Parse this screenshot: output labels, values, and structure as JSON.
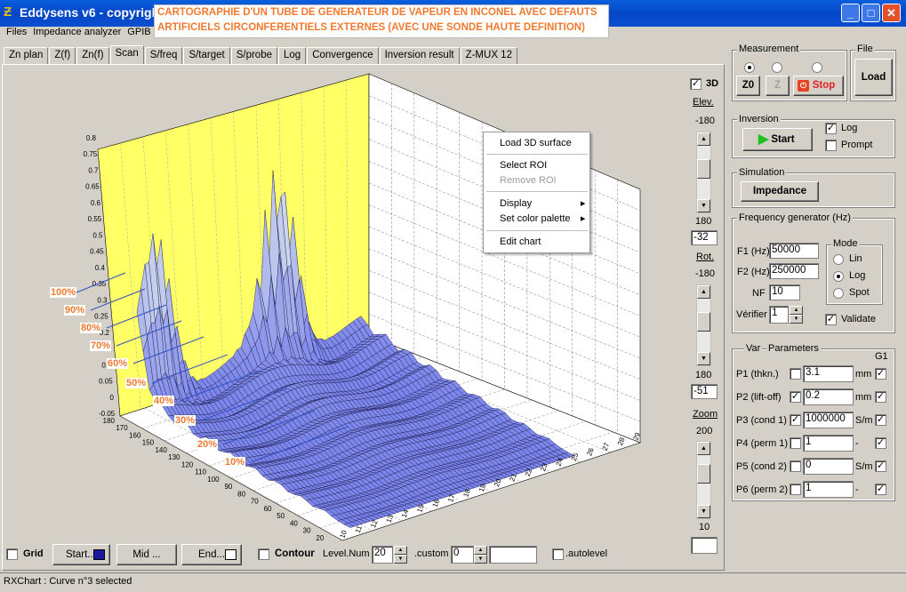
{
  "window": {
    "title": "Eddysens v6 - copyright"
  },
  "banner": {
    "line1": "CARTOGRAPHIE D'UN TUBE DE GENERATEUR DE VAPEUR EN INCONEL AVEC DEFAUTS",
    "line2": "ARTIFICIELS CIRCONFERENTIELS EXTERNES (AVEC UNE SONDE HAUTE DEFINITION)"
  },
  "menu": [
    "Files",
    "Impedance analyzer",
    "GPIB"
  ],
  "tabs": [
    "Zn plan",
    "Z(f)",
    "Zn(f)",
    "Scan",
    "S/freq",
    "S/target",
    "S/probe",
    "Log",
    "Convergence",
    "Inversion result",
    "Z-MUX 12"
  ],
  "active_tab": "Scan",
  "plot": {
    "z_ticks": [
      "0.8",
      "0.75",
      "0.7",
      "0.65",
      "0.6",
      "0.55",
      "0.5",
      "0.45",
      "0.4",
      "0.35",
      "0.3",
      "0.25",
      "0.2",
      "0.15",
      "0.1",
      "0.05",
      "0",
      "-0.05"
    ],
    "y_ticks": [
      "10",
      "20",
      "30",
      "40",
      "50",
      "60",
      "70",
      "80",
      "90",
      "100",
      "110",
      "120",
      "130",
      "140",
      "150",
      "160",
      "170",
      "180"
    ],
    "x_ticks": [
      "10",
      "11",
      "12",
      "13",
      "14",
      "15",
      "16",
      "17",
      "18",
      "19",
      "20",
      "21",
      "22",
      "23",
      "24",
      "25",
      "26",
      "27",
      "28",
      "29"
    ],
    "percent_labels": [
      "100%",
      "90%",
      "80%",
      "70%",
      "60%",
      "50%",
      "40%",
      "30%",
      "20%",
      "10%"
    ],
    "colors": {
      "wall": "#ffff66",
      "surface": "#8a95e8",
      "mesh": "#1a1a50",
      "floor": "#ffffff"
    }
  },
  "context_menu": {
    "items": [
      "Load 3D surface",
      "Select ROI",
      "Remove ROI",
      "Display",
      "Set color palette",
      "Edit chart"
    ]
  },
  "view3d": {
    "label_3d": "3D",
    "elev_label": "Elev.",
    "elev_max": "-180",
    "elev_min": "180",
    "elev_value": "-32",
    "rot_label": "Rot.",
    "rot_max": "-180",
    "rot_min": "180",
    "rot_value": "-51",
    "zoom_label": "Zoom",
    "zoom_max": "200",
    "zoom_min": "10",
    "zoom_value": ""
  },
  "measurement": {
    "label": "Measurement",
    "btn_z0": "Z0",
    "btn_z": "Z",
    "btn_stop": "Stop"
  },
  "file": {
    "label": "File",
    "btn_load": "Load"
  },
  "inversion": {
    "label": "Inversion",
    "btn_start": "Start",
    "log": "Log",
    "prompt": "Prompt"
  },
  "simulation": {
    "label": "Simulation",
    "btn_impedance": "Impedance"
  },
  "freqgen": {
    "label": "Frequency generator (Hz)",
    "f1_label": "F1 (Hz)",
    "f1_value": "50000",
    "f2_label": "F2 (Hz)",
    "f2_value": "250000",
    "nf_label": "NF",
    "nf_value": "10",
    "verifier_label": "Vérifier",
    "verifier_value": "1",
    "mode_label": "Mode",
    "mode_lin": "Lin",
    "mode_log": "Log",
    "mode_spot": "Spot",
    "validate": "Validate"
  },
  "params": {
    "label_var": "Var",
    "label_params": "Parameters",
    "label_g1": "G1",
    "rows": [
      {
        "name": "P1 (thkn.)",
        "value": "3.1",
        "unit": "mm",
        "var": false,
        "g1": true
      },
      {
        "name": "P2 (lift-off)",
        "value": "0.2",
        "unit": "mm",
        "var": true,
        "g1": true
      },
      {
        "name": "P3 (cond 1)",
        "value": "1000000",
        "unit": "S/m",
        "var": true,
        "g1": true
      },
      {
        "name": "P4 (perm 1)",
        "value": "1",
        "unit": "-",
        "var": false,
        "g1": true
      },
      {
        "name": "P5 (cond 2)",
        "value": "0",
        "unit": "S/m",
        "var": false,
        "g1": true
      },
      {
        "name": "P6 (perm 2)",
        "value": "1",
        "unit": "-",
        "var": false,
        "g1": true
      }
    ]
  },
  "bottom": {
    "grid": "Grid",
    "start": "Start...",
    "mid": "Mid ...",
    "end": "End...",
    "contour": "Contour",
    "level_num_label": "Level.Num",
    "level_num_value": "20",
    "custom_label": ".custom",
    "custom_value": "0",
    "autolevel": ".autolevel"
  },
  "status": "RXChart : Curve n°3 selected"
}
